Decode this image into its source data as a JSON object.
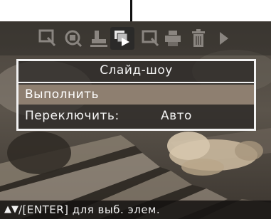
{
  "menu": {
    "title": "Слайд-шоу",
    "items": [
      {
        "label": "Выполнить",
        "selected": true
      },
      {
        "label": "Переключить:",
        "value": "Авто",
        "selected": false
      }
    ]
  },
  "toolbar": {
    "icons": [
      "select-zoom-icon",
      "rotate-icon",
      "stamp-icon",
      "slideshow-icon",
      "crop-icon",
      "print-icon",
      "trash-icon",
      "arrow-right-icon"
    ],
    "selected_icon": "slideshow-icon"
  },
  "status_bar": {
    "arrows": "▲▼",
    "hint": "/[ENTER] для выб. элем."
  },
  "colors": {
    "selection": "#8e7f70",
    "menu_border": "#f2f2f2",
    "text": "#f4f4f4"
  }
}
